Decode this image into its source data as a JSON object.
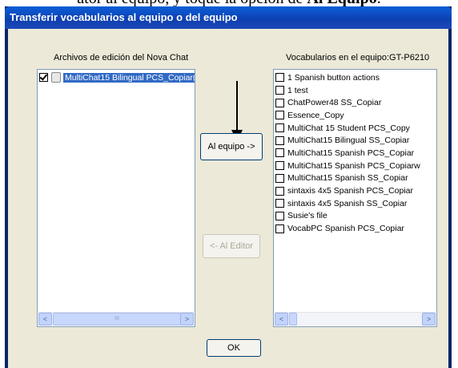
{
  "caption": {
    "prefix": "ator al equipo, y toque la opción de ",
    "bold": "Al Equipo",
    "suffix": "."
  },
  "window": {
    "title": "Transferir vocabularios al equipo o del equipo"
  },
  "left_panel": {
    "label": "Archivos de edición del Nova Chat",
    "items": [
      {
        "label": "MultiChat15 Bilingual PCS_Copiar(",
        "checked": true,
        "selected": true,
        "icon": "file-icon"
      }
    ]
  },
  "right_panel": {
    "label": "Vocabularios en el equipo:GT-P6210",
    "items": [
      {
        "label": "1 Spanish button actions",
        "checked": false
      },
      {
        "label": "1 test",
        "checked": false
      },
      {
        "label": "ChatPower48 SS_Copiar",
        "checked": false
      },
      {
        "label": "Essence_Copy",
        "checked": false
      },
      {
        "label": "MultiChat 15 Student PCS_Copy",
        "checked": false
      },
      {
        "label": "MultiChat15 Bilingual SS_Copiar",
        "checked": false
      },
      {
        "label": "MultiChat15 Spanish PCS_Copiar",
        "checked": false
      },
      {
        "label": "MultiChat15 Spanish PCS_Copiarw",
        "checked": false
      },
      {
        "label": "MultiChat15 Spanish SS_Copiar",
        "checked": false
      },
      {
        "label": "sintaxis 4x5 Spanish PCS_Copiar",
        "checked": false
      },
      {
        "label": "sintaxis 4x5 Spanish SS_Copiar",
        "checked": false
      },
      {
        "label": "Susie's file",
        "checked": false
      },
      {
        "label": "VocabPC Spanish PCS_Copiar",
        "checked": false
      }
    ]
  },
  "buttons": {
    "to_device": "Al equipo ->",
    "to_editor": "<- Al Editor",
    "ok": "OK"
  },
  "scrollbar": {
    "left_arrow": "<",
    "right_arrow": ">",
    "grip": "III"
  },
  "colors": {
    "title_bar": "#0f3fb0",
    "dialog_face": "#ece9d8",
    "selection": "#316ac5",
    "disabled_text": "#aca899"
  }
}
